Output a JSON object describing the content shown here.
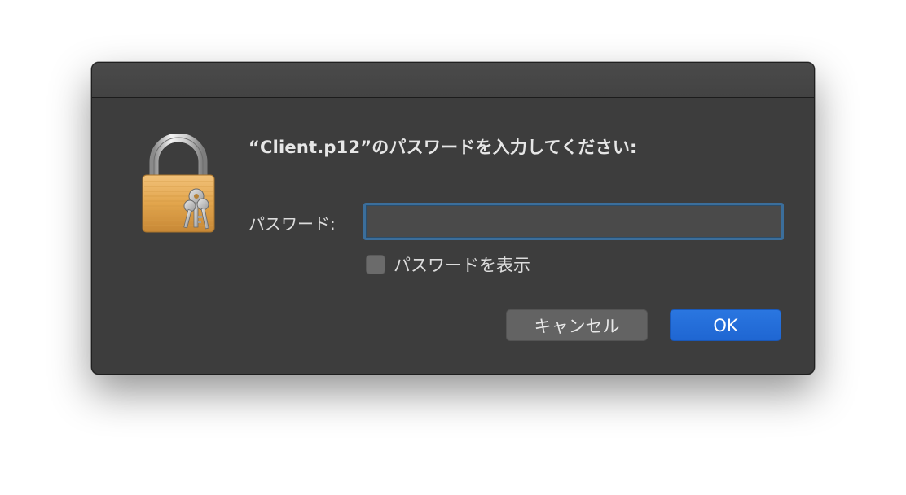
{
  "dialog": {
    "prompt": "“Client.p12”のパスワードを入力してください:",
    "password_label": "パスワード:",
    "password_value": "",
    "show_password_label": "パスワードを表示",
    "show_password_checked": false,
    "cancel_label": "キャンセル",
    "ok_label": "OK",
    "icon": "keychain-lock-icon"
  },
  "colors": {
    "dialog_bg": "#3d3d3d",
    "accent": "#2a76e0",
    "focus_ring": "#3b6e9b",
    "lock_gold": "#e2a54c"
  }
}
